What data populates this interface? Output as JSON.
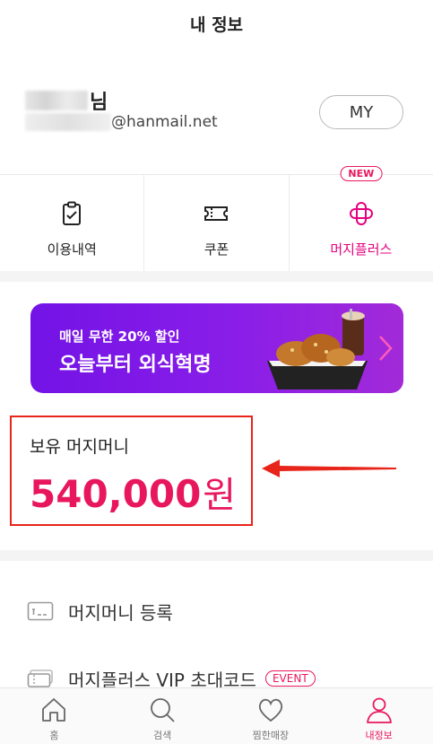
{
  "header": {
    "title": "내 정보"
  },
  "profile": {
    "name_suffix": "님",
    "email_domain": "@hanmail.net",
    "my_button": "MY"
  },
  "quick_menu": {
    "items": [
      {
        "label": "이용내역",
        "icon": "clipboard-icon"
      },
      {
        "label": "쿠폰",
        "icon": "ticket-icon"
      },
      {
        "label": "머지플러스",
        "icon": "merge-plus-icon",
        "badge": "NEW"
      }
    ]
  },
  "banner": {
    "subtitle": "매일 무한 20% 할인",
    "title": "오늘부터 외식혁명"
  },
  "balance": {
    "label": "보유 머지머니",
    "amount": "540,000",
    "unit": "원"
  },
  "menu": {
    "items": [
      {
        "label": "머지머니 등록",
        "icon": "card-icon"
      },
      {
        "label": "머지플러스 VIP 초대코드",
        "icon": "ticket-stack-icon",
        "badge": "EVENT"
      }
    ]
  },
  "tabbar": {
    "items": [
      {
        "label": "홈",
        "icon": "home-icon"
      },
      {
        "label": "검색",
        "icon": "search-icon"
      },
      {
        "label": "찜한매장",
        "icon": "heart-icon"
      },
      {
        "label": "내정보",
        "icon": "person-icon",
        "active": true
      }
    ]
  },
  "colors": {
    "accent": "#e8175d",
    "banner_purple": "#7a18e6",
    "annotation_red": "#e8251b"
  }
}
